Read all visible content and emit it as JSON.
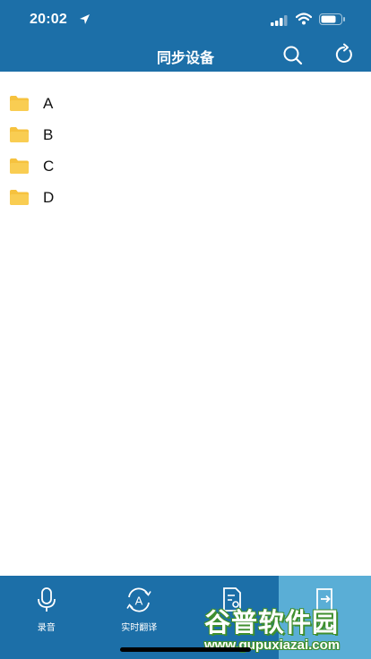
{
  "status_bar": {
    "time": "20:02"
  },
  "header": {
    "title": "同步设备",
    "search_icon": "search-icon",
    "refresh_icon": "refresh-icon"
  },
  "folders": [
    {
      "label": "A",
      "icon": "folder-icon"
    },
    {
      "label": "B",
      "icon": "folder-icon"
    },
    {
      "label": "C",
      "icon": "folder-icon"
    },
    {
      "label": "D",
      "icon": "folder-icon"
    }
  ],
  "tabs": [
    {
      "label": "录音",
      "icon": "microphone-icon",
      "active": false
    },
    {
      "label": "实时翻译",
      "icon": "translate-icon",
      "active": false
    },
    {
      "label": "",
      "icon": "document-search-icon",
      "active": false
    },
    {
      "label": "",
      "icon": "sync-export-icon",
      "active": true
    }
  ],
  "watermark": {
    "title": "谷普软件园",
    "url": "www.gupuxiazai.com"
  },
  "colors": {
    "bar": "#1c6fa8",
    "active_tab": "#5aaed6",
    "folder": "#f6c23e"
  }
}
